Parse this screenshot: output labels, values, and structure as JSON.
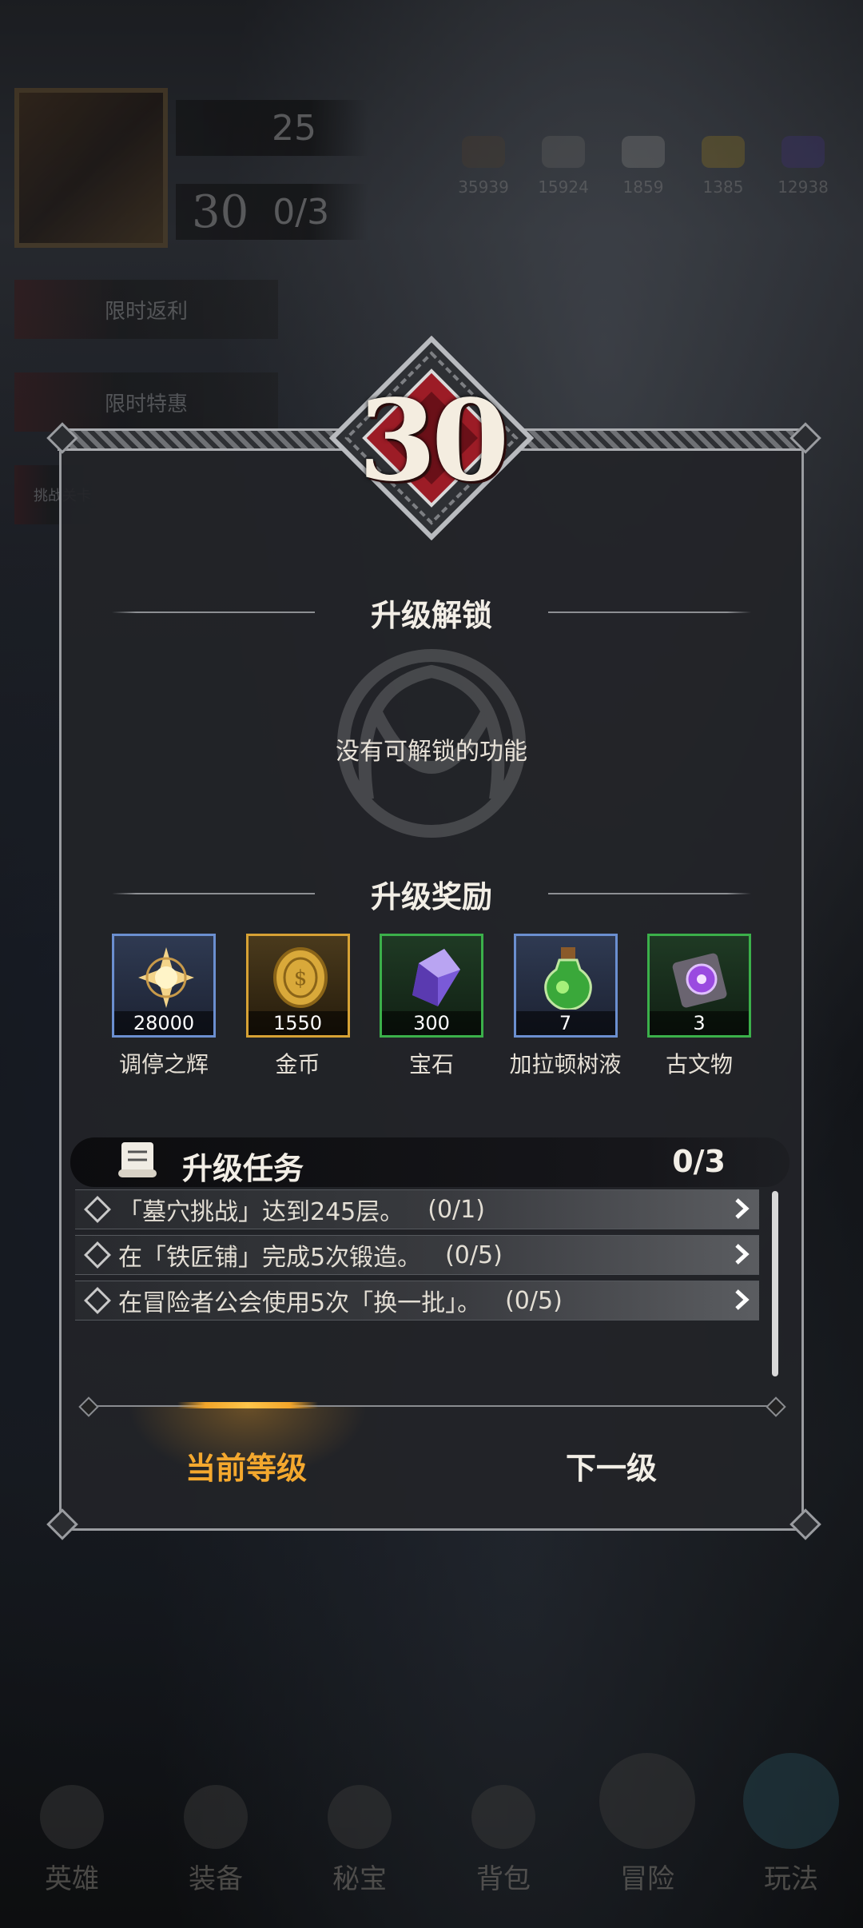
{
  "hud": {
    "gem_count": "25",
    "player_level": "30",
    "stamina": "0/3",
    "resources": [
      "35939",
      "15924",
      "1859",
      "1385",
      "12938"
    ]
  },
  "side_banners": [
    "限时返利",
    "限时特惠",
    "挑战关卡"
  ],
  "level_up": {
    "level": "30",
    "unlock_title": "升级解锁",
    "unlock_empty_text": "没有可解锁的功能",
    "rewards_title": "升级奖励",
    "rewards": [
      {
        "name": "调停之辉",
        "qty": "28000",
        "rarity_color": "#6b8fd0",
        "icon": "radiant-star-icon"
      },
      {
        "name": "金币",
        "qty": "1550",
        "rarity_color": "#d7a234",
        "icon": "gold-coin-icon"
      },
      {
        "name": "宝石",
        "qty": "300",
        "rarity_color": "#3bb04a",
        "icon": "purple-crystal-icon"
      },
      {
        "name": "加拉顿树液",
        "qty": "7",
        "rarity_color": "#6b8fd0",
        "icon": "green-potion-icon"
      },
      {
        "name": "古文物",
        "qty": "3",
        "rarity_color": "#3bb04a",
        "icon": "purple-relic-icon"
      }
    ],
    "tasks_title": "升级任务",
    "tasks_progress": "0/3",
    "tasks": [
      {
        "text": "「墓穴挑战」达到245层。",
        "progress": "(0/1)"
      },
      {
        "text": "在「铁匠铺」完成5次锻造。",
        "progress": "(0/5)"
      },
      {
        "text": "在冒险者公会使用5次「换一批」。",
        "progress": "(0/5)"
      }
    ],
    "tabs": {
      "current": "当前等级",
      "next": "下一级"
    }
  },
  "bottom_nav": [
    "英雄",
    "装备",
    "秘宝",
    "背包",
    "冒险",
    "玩法"
  ],
  "colors": {
    "accent": "#f4a82e",
    "panel_border": "#9a9ca0",
    "badge_red": "#b0202a"
  }
}
